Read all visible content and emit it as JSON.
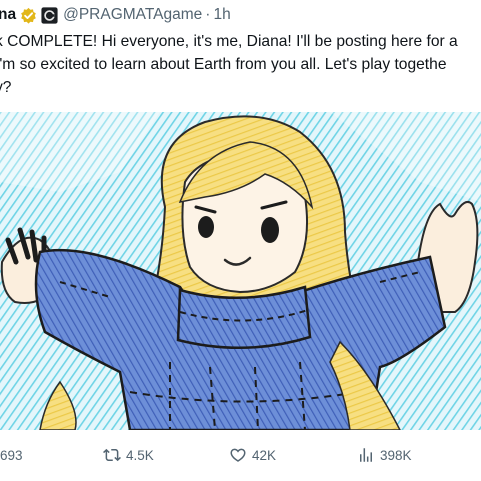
{
  "author": {
    "name": "na",
    "handle": "@PRAGMATAgame",
    "separator": "·",
    "time": "1h"
  },
  "tweet": {
    "lines": [
      "k COMPLETE! Hi everyone, it's me, Diana! I'll be posting here for a",
      "I'm so excited to learn about Earth from you all. Let's play togethe",
      "y?"
    ]
  },
  "actions": {
    "replies": "693",
    "reposts": "4.5K",
    "likes": "42K",
    "views": "398K"
  },
  "colors": {
    "verified_badge": "#e2b719",
    "secondary_text": "#536471",
    "sweater_blue": "#4f73c9",
    "hair_yellow": "#f3d45f",
    "background_cyan": "#6fd4e6"
  },
  "icons": [
    "verified-badge-icon",
    "pragmata-logo-icon",
    "reply-icon",
    "repost-icon",
    "like-icon",
    "views-icon"
  ]
}
